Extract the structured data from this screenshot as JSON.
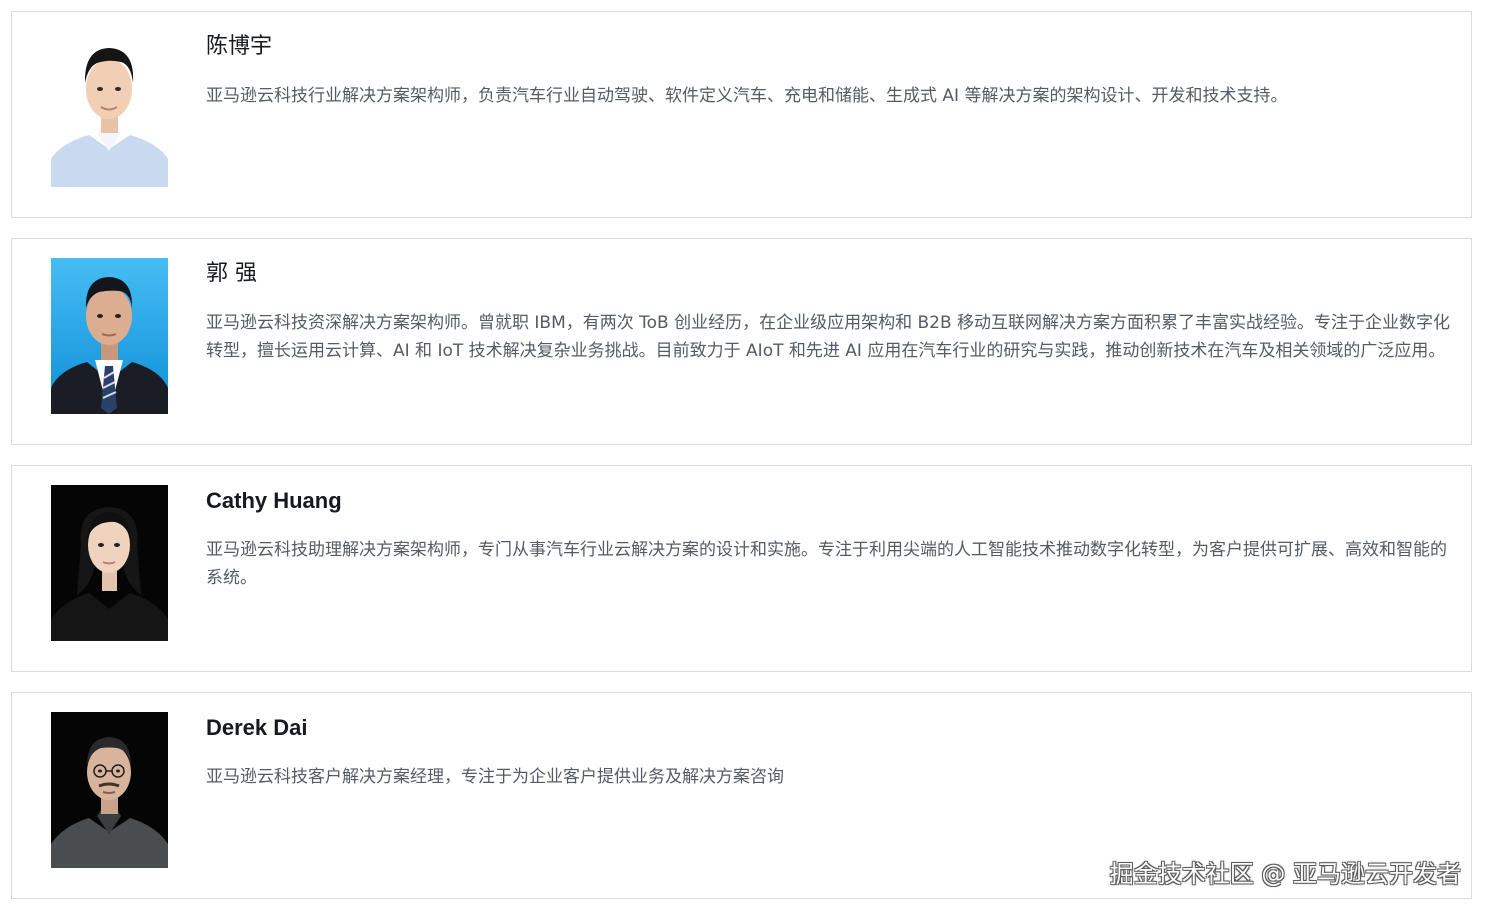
{
  "profiles": [
    {
      "name": "陈博宇",
      "bio": "亚马逊云科技行业解决方案架构师，负责汽车行业自动驾驶、软件定义汽车、充电和储能、生成式 AI 等解决方案的架构设计、开发和技术支持。",
      "photo_bg": "#ffffff",
      "shirt_color": "#c9d9ef"
    },
    {
      "name": "郭 强",
      "bio": "亚马逊云科技资深解决方案架构师。曾就职 IBM，有两次 ToB 创业经历，在企业级应用架构和 B2B 移动互联网解决方案方面积累了丰富实战经验。专注于企业数字化转型，擅长运用云计算、AI 和 IoT 技术解决复杂业务挑战。目前致力于 AIoT 和先进 AI 应用在汽车行业的研究与实践，推动创新技术在汽车及相关领域的广泛应用。",
      "photo_bg": "#1aa3e8",
      "shirt_color": "#1a1d24"
    },
    {
      "name": "Cathy Huang",
      "bio": "亚马逊云科技助理解决方案架构师，专门从事汽车行业云解决方案的设计和实施。专注于利用尖端的人工智能技术推动数字化转型，为客户提供可扩展、高效和智能的系统。",
      "photo_bg": "#050505",
      "shirt_color": "#151515"
    },
    {
      "name": "Derek Dai",
      "bio": "亚马逊云科技客户解决方案经理，专注于为企业客户提供业务及解决方案咨询",
      "photo_bg": "#050505",
      "shirt_color": "#4a4d4f"
    }
  ],
  "watermark": "掘金技术社区 @ 亚马逊云开发者"
}
